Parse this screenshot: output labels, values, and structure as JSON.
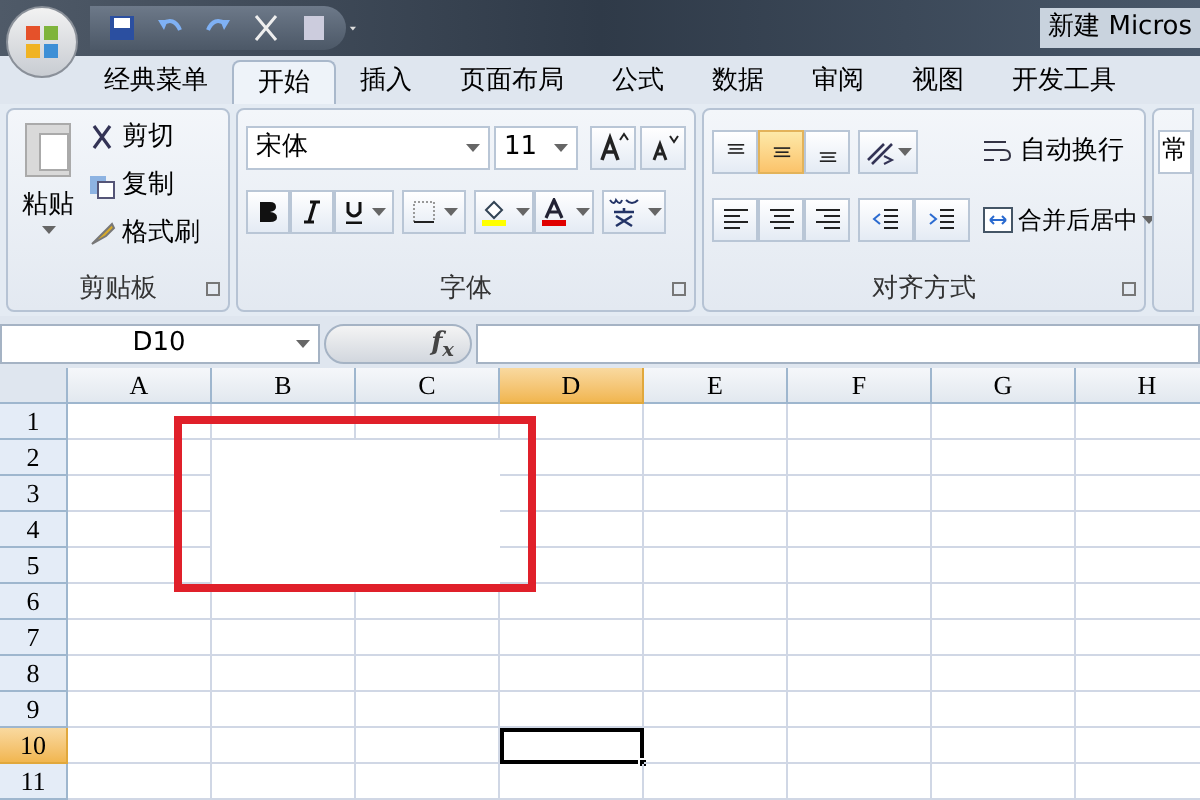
{
  "window": {
    "title": "新建 Micros"
  },
  "tabs": [
    {
      "label": "经典菜单",
      "selected": false
    },
    {
      "label": "开始",
      "selected": true
    },
    {
      "label": "插入",
      "selected": false
    },
    {
      "label": "页面布局",
      "selected": false
    },
    {
      "label": "公式",
      "selected": false
    },
    {
      "label": "数据",
      "selected": false
    },
    {
      "label": "审阅",
      "selected": false
    },
    {
      "label": "视图",
      "selected": false
    },
    {
      "label": "开发工具",
      "selected": false
    }
  ],
  "clipboard": {
    "label": "剪贴板",
    "paste": "粘贴",
    "cut": "剪切",
    "copy": "复制",
    "format_painter": "格式刷"
  },
  "font": {
    "label": "字体",
    "font_name": "宋体",
    "font_size": "11"
  },
  "alignment": {
    "label": "对齐方式",
    "vertical": [
      {
        "kind": "top",
        "selected": false
      },
      {
        "kind": "middle",
        "selected": true
      },
      {
        "kind": "bottom",
        "selected": false
      }
    ],
    "wrap_text": "自动换行",
    "merge_center": "合并后居中"
  },
  "number": {
    "format": "常"
  },
  "formula_bar": {
    "name_box": "D10",
    "fx": "f$_{x}$"
  },
  "columns": [
    {
      "label": "A",
      "selected": false
    },
    {
      "label": "B",
      "selected": false
    },
    {
      "label": "C",
      "selected": false
    },
    {
      "label": "D",
      "selected": true
    },
    {
      "label": "E",
      "selected": false
    },
    {
      "label": "F",
      "selected": false
    },
    {
      "label": "G",
      "selected": false
    },
    {
      "label": "H",
      "selected": false
    }
  ],
  "rows": [
    {
      "label": "1",
      "selected": false
    },
    {
      "label": "2",
      "selected": false
    },
    {
      "label": "3",
      "selected": false
    },
    {
      "label": "4",
      "selected": false
    },
    {
      "label": "5",
      "selected": false
    },
    {
      "label": "6",
      "selected": false
    },
    {
      "label": "7",
      "selected": false
    },
    {
      "label": "8",
      "selected": false
    },
    {
      "label": "9",
      "selected": false
    },
    {
      "label": "10",
      "selected": true
    },
    {
      "label": "11",
      "selected": false
    }
  ]
}
